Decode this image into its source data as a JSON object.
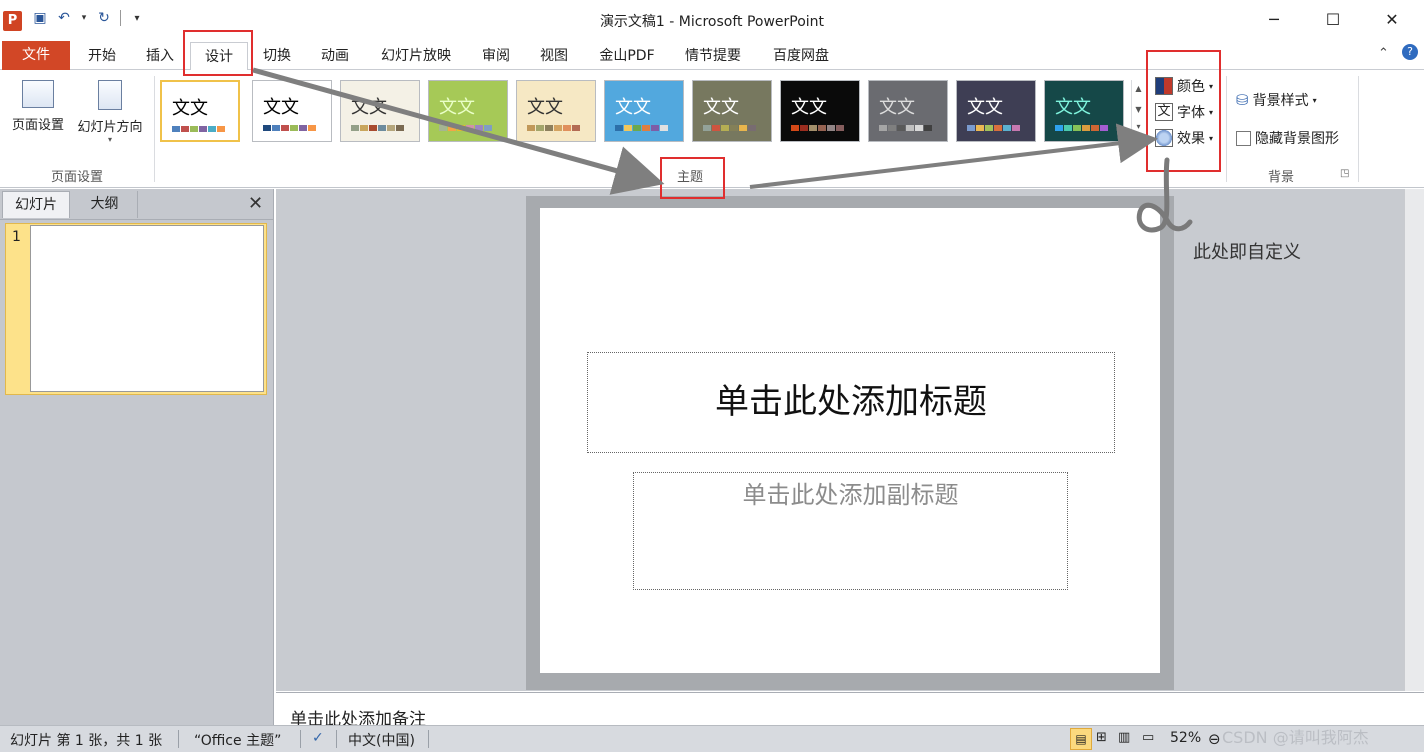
{
  "app": {
    "title": "演示文稿1 - Microsoft PowerPoint",
    "icon_letter": "P"
  },
  "window_controls": {
    "minimize": "─",
    "maximize": "☐",
    "close": "✕"
  },
  "quick_access": {
    "save_icon": "save-icon",
    "undo_icon": "undo-icon",
    "redo_icon": "redo-icon",
    "customize_icon": "customize-icon"
  },
  "tabs": {
    "file": "文件",
    "home": "开始",
    "insert": "插入",
    "design": "设计",
    "transitions": "切换",
    "animations": "动画",
    "slideshow": "幻灯片放映",
    "review": "审阅",
    "view": "视图",
    "kingsoft_pdf": "金山PDF",
    "storyboard": "情节提要",
    "baidu": "百度网盘"
  },
  "ribbon": {
    "page_setup_group": {
      "label": "页面设置",
      "page_setup_btn": "页面设置",
      "orientation_btn": "幻灯片方向"
    },
    "themes_group": {
      "label": "主题",
      "sample_text": "文文",
      "themes": [
        {
          "bg": "#ffffff",
          "fg": "#000000",
          "sw": [
            "#4f81bd",
            "#c0504d",
            "#9bbb59",
            "#8064a2",
            "#4bacc6",
            "#f79646"
          ]
        },
        {
          "bg": "#ffffff",
          "fg": "#000000",
          "sw": [
            "#1f497d",
            "#4f81bd",
            "#c0504d",
            "#9bbb59",
            "#8064a2",
            "#f79646"
          ]
        },
        {
          "bg": "#f4f1e6",
          "fg": "#333333",
          "sw": [
            "#94a088",
            "#c9a65c",
            "#a84b2f",
            "#6d8c9e",
            "#b5a67c",
            "#7a6a52"
          ]
        },
        {
          "bg": "#a6c957",
          "fg": "#eaffc8",
          "sw": [
            "#a5b592",
            "#f3a447",
            "#e7bc29",
            "#d092a7",
            "#9c85c0",
            "#809ec2"
          ]
        },
        {
          "bg": "#f6e8c4",
          "fg": "#333333",
          "sw": [
            "#c19859",
            "#a3a56b",
            "#8d7f5d",
            "#d3a260",
            "#e08f5c",
            "#b36b53"
          ]
        },
        {
          "bg": "#52a8de",
          "fg": "#ffffff",
          "sw": [
            "#2c6fa9",
            "#f2c75c",
            "#6aa84f",
            "#df7d40",
            "#7e5ca6",
            "#e0e0e0"
          ]
        },
        {
          "bg": "#77785f",
          "fg": "#ffffff",
          "sw": [
            "#93a299",
            "#cf543f",
            "#b5ae53",
            "#848058",
            "#e8b54d",
            "#786c71"
          ]
        },
        {
          "bg": "#0a0a0a",
          "fg": "#ffffff",
          "sw": [
            "#d34817",
            "#9b2d1f",
            "#a28e6a",
            "#956251",
            "#918485",
            "#855d5d"
          ]
        },
        {
          "bg": "#6a6b70",
          "fg": "#dddddd",
          "sw": [
            "#a5a5a5",
            "#7f7f7f",
            "#595959",
            "#bfbfbf",
            "#d8d8d8",
            "#404040"
          ]
        },
        {
          "bg": "#3e3e54",
          "fg": "#ffffff",
          "sw": [
            "#7a9bcf",
            "#ebb853",
            "#a3c15b",
            "#da6f3d",
            "#5bb1d0",
            "#c678b0"
          ]
        },
        {
          "bg": "#154848",
          "fg": "#7ff4dd",
          "sw": [
            "#2fa3ee",
            "#4bcaad",
            "#86c157",
            "#d99c3f",
            "#ce6633",
            "#a35dd1"
          ]
        }
      ]
    },
    "custom_group": {
      "colors_btn": "颜色",
      "fonts_btn": "字体",
      "effects_btn": "效果"
    },
    "background_group": {
      "label": "背景",
      "background_styles_btn": "背景样式",
      "hide_bg_graphics": "隐藏背景图形"
    }
  },
  "left_pane": {
    "tab_slides": "幻灯片",
    "tab_outline": "大纲",
    "close": "✕",
    "slide_number": "1"
  },
  "slide": {
    "title_placeholder": "单击此处添加标题",
    "subtitle_placeholder": "单击此处添加副标题"
  },
  "notes": {
    "placeholder": "单击此处添加备注"
  },
  "status_bar": {
    "slide_info": "幻灯片 第 1 张，共 1 张",
    "theme_name": "“Office 主题”",
    "language": "中文(中国)",
    "zoom": "52%"
  },
  "annotations": {
    "customize_note": "此处即自定义",
    "red_box_color": "#e02e2e",
    "arrow_color": "#7f7f7f"
  },
  "watermark": "CSDN @请叫我阿杰"
}
